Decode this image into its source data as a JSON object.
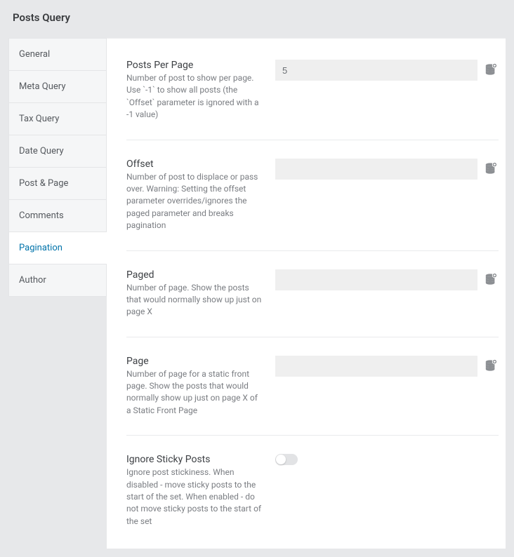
{
  "page": {
    "title": "Posts Query"
  },
  "sidebar": {
    "items": [
      {
        "label": "General"
      },
      {
        "label": "Meta Query"
      },
      {
        "label": "Tax Query"
      },
      {
        "label": "Date Query"
      },
      {
        "label": "Post & Page"
      },
      {
        "label": "Comments"
      },
      {
        "label": "Pagination"
      },
      {
        "label": "Author"
      }
    ],
    "active_index": 6
  },
  "fields": {
    "posts_per_page": {
      "title": "Posts Per Page",
      "desc": "Number of post to show per page. Use `-1` to show all posts (the `Offset` parameter is ignored with a -1 value)",
      "value": "5"
    },
    "offset": {
      "title": "Offset",
      "desc": "Number of post to displace or pass over. Warning: Setting the offset parameter overrides/ignores the paged parameter and breaks pagination",
      "value": ""
    },
    "paged": {
      "title": "Paged",
      "desc": "Number of page. Show the posts that would normally show up just on page X",
      "value": ""
    },
    "page": {
      "title": "Page",
      "desc": "Number of page for a static front page. Show the posts that would normally show up just on page X of a Static Front Page",
      "value": ""
    },
    "ignore_sticky": {
      "title": "Ignore Sticky Posts",
      "desc": "Ignore post stickiness. When disabled - move sticky posts to the start of the set. When enabled - do not move sticky posts to the start of the set",
      "enabled": false
    }
  }
}
